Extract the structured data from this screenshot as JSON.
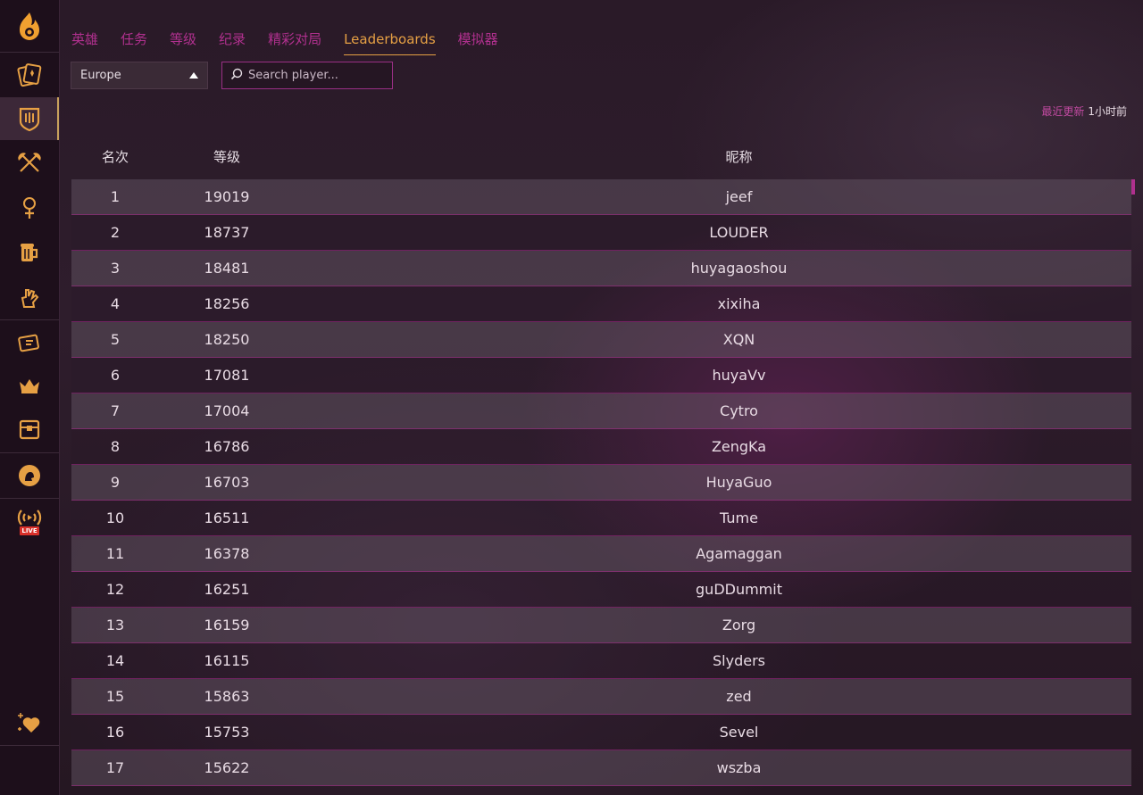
{
  "sidebar": {
    "items": [
      {
        "icon": "hearthstone-logo-icon",
        "active": false
      },
      {
        "icon": "card-collection-icon",
        "active": false
      },
      {
        "icon": "battlegrounds-icon",
        "active": true
      },
      {
        "icon": "crossed-axes-icon",
        "active": false
      },
      {
        "icon": "mercenary-icon",
        "active": false
      },
      {
        "icon": "tavern-mug-icon",
        "active": false
      },
      {
        "icon": "hand-icon",
        "active": false
      },
      {
        "icon": "ticket-icon",
        "active": false
      },
      {
        "icon": "crown-icon",
        "active": false
      },
      {
        "icon": "treasure-chest-icon",
        "active": false
      },
      {
        "icon": "hero-portrait-icon",
        "active": false
      },
      {
        "icon": "live-stream-icon",
        "active": false,
        "badge": "LIVE"
      },
      {
        "icon": "heart-sparkle-icon",
        "active": false
      }
    ]
  },
  "tabs": [
    {
      "label": "英雄",
      "active": false
    },
    {
      "label": "任务",
      "active": false
    },
    {
      "label": "等级",
      "active": false
    },
    {
      "label": "纪录",
      "active": false
    },
    {
      "label": "精彩对局",
      "active": false
    },
    {
      "label": "Leaderboards",
      "active": true
    },
    {
      "label": "模拟器",
      "active": false
    }
  ],
  "region": {
    "selected": "Europe"
  },
  "search": {
    "placeholder": "Search player..."
  },
  "updated": {
    "label": "最近更新",
    "value": "1小时前"
  },
  "table": {
    "headers": {
      "rank": "名次",
      "level": "等级",
      "name": "昵称"
    },
    "rows": [
      {
        "rank": "1",
        "level": "19019",
        "name": "jeef"
      },
      {
        "rank": "2",
        "level": "18737",
        "name": "LOUDER"
      },
      {
        "rank": "3",
        "level": "18481",
        "name": "huyagaoshou"
      },
      {
        "rank": "4",
        "level": "18256",
        "name": "xixiha"
      },
      {
        "rank": "5",
        "level": "18250",
        "name": "XQN"
      },
      {
        "rank": "6",
        "level": "17081",
        "name": "huyaVv"
      },
      {
        "rank": "7",
        "level": "17004",
        "name": "Cytro"
      },
      {
        "rank": "8",
        "level": "16786",
        "name": "ZengKa"
      },
      {
        "rank": "9",
        "level": "16703",
        "name": "HuyaGuo"
      },
      {
        "rank": "10",
        "level": "16511",
        "name": "Tume"
      },
      {
        "rank": "11",
        "level": "16378",
        "name": "Agamaggan"
      },
      {
        "rank": "12",
        "level": "16251",
        "name": "guDDummit"
      },
      {
        "rank": "13",
        "level": "16159",
        "name": "Zorg"
      },
      {
        "rank": "14",
        "level": "16115",
        "name": "Slyders"
      },
      {
        "rank": "15",
        "level": "15863",
        "name": "zed"
      },
      {
        "rank": "16",
        "level": "15753",
        "name": "Sevel"
      },
      {
        "rank": "17",
        "level": "15622",
        "name": "wszba"
      }
    ]
  },
  "colors": {
    "accent": "#e6a044",
    "tab": "#b0308e",
    "icon": "#e6a044"
  }
}
